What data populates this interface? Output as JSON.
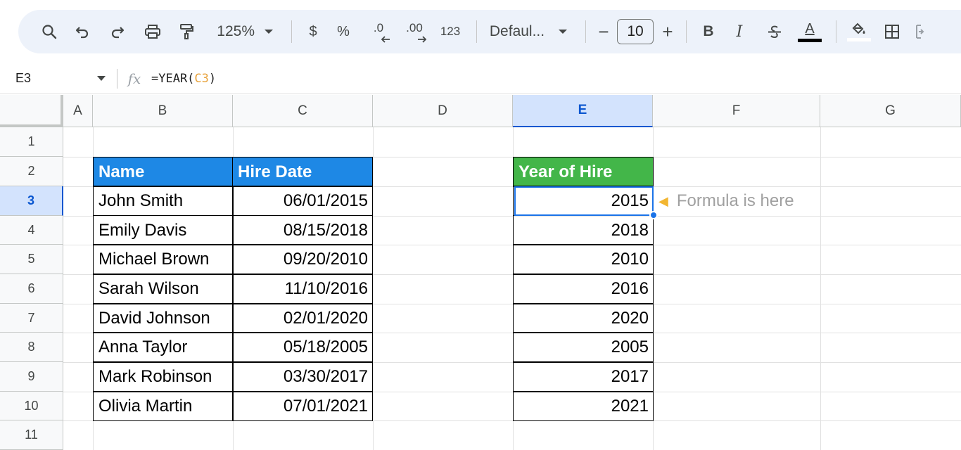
{
  "toolbar": {
    "zoom": "125%",
    "currency": "$",
    "percent": "%",
    "decrease_decimal": ".0",
    "increase_decimal": ".00",
    "number_format": "123",
    "font": "Defaul...",
    "minus": "−",
    "font_size": "10",
    "plus": "+",
    "bold": "B",
    "italic": "I",
    "text_color_letter": "A",
    "accent_color": "#0b57d0",
    "icons": [
      "search-icon",
      "undo-icon",
      "redo-icon",
      "print-icon",
      "paint-format-icon",
      "chevron-down-icon",
      "strikethrough-icon",
      "fill-color-icon",
      "borders-icon",
      "merge-icon"
    ]
  },
  "formula_bar": {
    "name_box": "E3",
    "fx": "fx",
    "formula_prefix": "=YEAR(",
    "formula_ref": "C3",
    "formula_suffix": ")"
  },
  "columns": [
    "A",
    "B",
    "C",
    "D",
    "E",
    "F",
    "G"
  ],
  "selected_column": "E",
  "rows": [
    "1",
    "2",
    "3",
    "4",
    "5",
    "6",
    "7",
    "8",
    "9",
    "10",
    "11"
  ],
  "selected_row": "3",
  "table": {
    "headers": [
      "Name",
      "Hire Date"
    ],
    "header_color": "#1e88e5",
    "data": [
      [
        "John Smith",
        "06/01/2015"
      ],
      [
        "Emily Davis",
        "08/15/2018"
      ],
      [
        "Michael Brown",
        "09/20/2010"
      ],
      [
        "Sarah Wilson",
        "11/10/2016"
      ],
      [
        "David Johnson",
        "02/01/2020"
      ],
      [
        "Anna Taylor",
        "05/18/2005"
      ],
      [
        "Mark Robinson",
        "03/30/2017"
      ],
      [
        "Olivia Martin",
        "07/01/2021"
      ]
    ]
  },
  "year_table": {
    "header": "Year of Hire",
    "header_color": "#43b649",
    "values": [
      "2015",
      "2018",
      "2010",
      "2016",
      "2020",
      "2005",
      "2017",
      "2021"
    ]
  },
  "note": {
    "icon": "pointing-hand-icon",
    "text": "Formula is here"
  }
}
